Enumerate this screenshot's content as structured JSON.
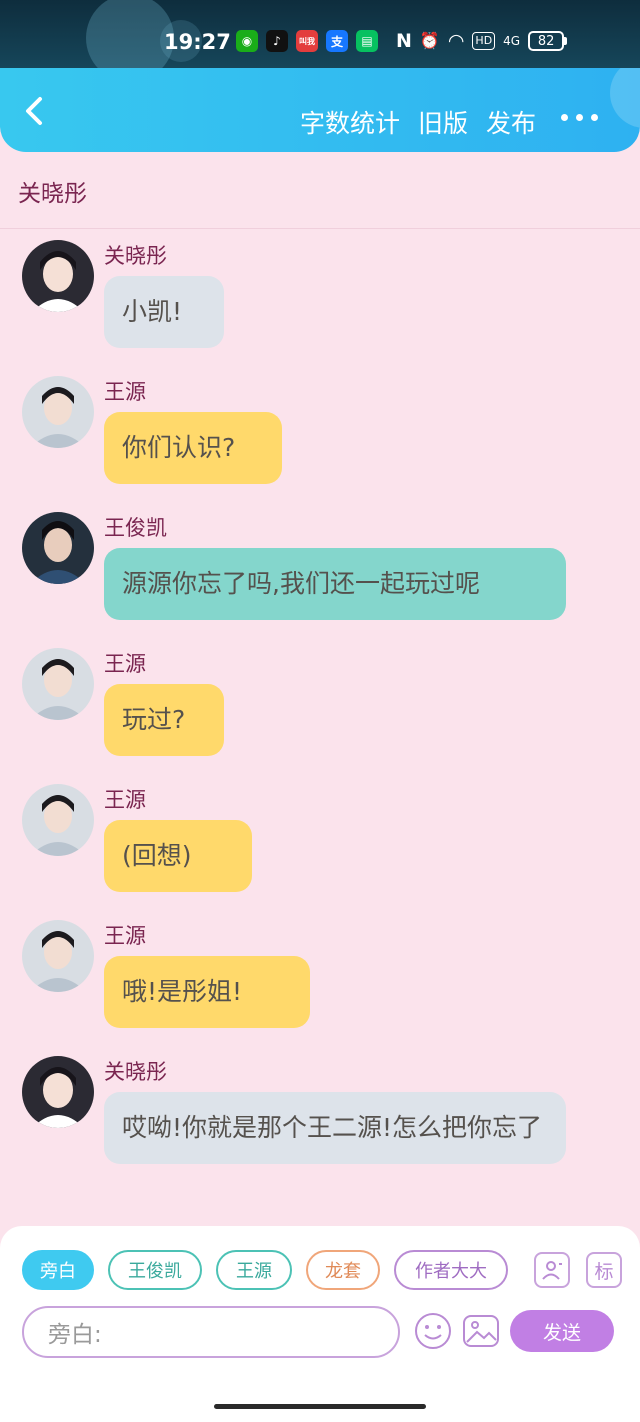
{
  "status_bar": {
    "time": "19:27",
    "app_icons": [
      "wechat-icon",
      "tiktok-icon",
      "app-icon",
      "alipay-icon",
      "message-icon"
    ],
    "app_colors": [
      "#1aad19",
      "#111111",
      "#e33d3d",
      "#1677ff",
      "#07c160"
    ],
    "app_glyphs": [
      "◉",
      "♪",
      "叫我",
      "支",
      "▤"
    ],
    "system_icons": [
      "nfc-icon",
      "alarm-icon",
      "wifi-icon",
      "hd-icon",
      "signal-icon"
    ],
    "system_glyphs": [
      "N",
      "⏰",
      "◠",
      "HD",
      "4G"
    ],
    "battery": "82"
  },
  "header": {
    "actions": [
      "字数统计",
      "旧版",
      "发布"
    ]
  },
  "chat_title": "关晓彤",
  "messages": [
    {
      "sender": "关晓彤",
      "text": "小凯!",
      "style": "gray",
      "avatar": "female-avatar"
    },
    {
      "sender": "王源",
      "text": "你们认识?",
      "style": "yellow",
      "avatar": "male-avatar-light"
    },
    {
      "sender": "王俊凯",
      "text": "源源你忘了吗,我们还一起玩过呢",
      "style": "teal",
      "avatar": "male-avatar-dark"
    },
    {
      "sender": "王源",
      "text": "玩过?",
      "style": "yellow",
      "avatar": "male-avatar-light"
    },
    {
      "sender": "王源",
      "text": "(回想)",
      "style": "yellow",
      "avatar": "male-avatar-light"
    },
    {
      "sender": "王源",
      "text": "哦!是彤姐!",
      "style": "yellow",
      "avatar": "male-avatar-light"
    },
    {
      "sender": "关晓彤",
      "text": "哎呦!你就是那个王二源!怎么把你忘了",
      "style": "gray",
      "avatar": "female-avatar"
    }
  ],
  "role_chips": [
    {
      "label": "旁白",
      "active": true,
      "color": "#3fcaf0"
    },
    {
      "label": "王俊凯",
      "active": false,
      "color": "#4cc2b5"
    },
    {
      "label": "王源",
      "active": false,
      "color": "#4cc2b5"
    },
    {
      "label": "龙套",
      "active": false,
      "color": "#f0a67a"
    },
    {
      "label": "作者大大",
      "active": false,
      "color": "#b98bd4"
    }
  ],
  "tag_button": "标",
  "input": {
    "placeholder": "旁白:"
  },
  "send_label": "发送"
}
